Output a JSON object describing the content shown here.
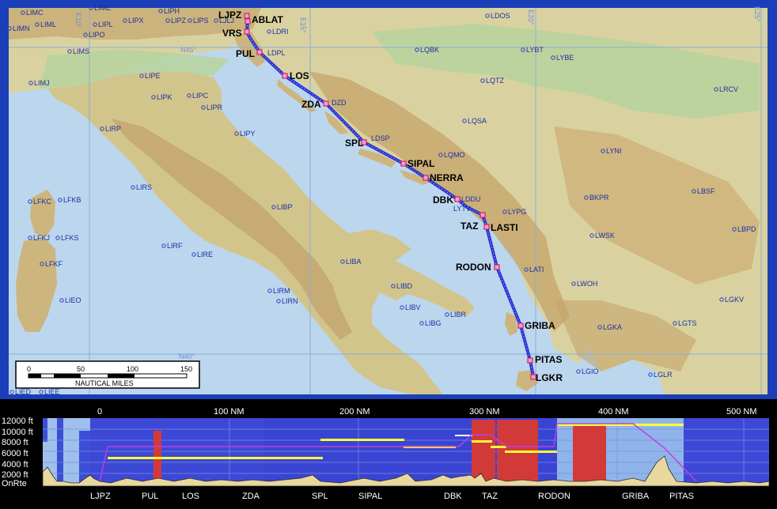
{
  "map": {
    "grid_labels": [
      "E10°",
      "E15°",
      "E20°",
      "E25°",
      "N45°",
      "N40°"
    ],
    "airports": [
      "LIMC",
      "LIME",
      "LIPH",
      "LIMN",
      "LIML",
      "LIPL",
      "LIPX",
      "LIPZ",
      "LIPS",
      "LJLJ",
      "LIPO",
      "LDRI",
      "LIMS",
      "LQBK",
      "LDOS",
      "LYBT",
      "LYBE",
      "LIPE",
      "LIMJ",
      "LIPK",
      "LIPC",
      "LIPR",
      "LQTZ",
      "LRCV",
      "LIRP",
      "LIPY",
      "LQSA",
      "LQMO",
      "LYNI",
      "LIRS",
      "LFKC",
      "LFKB",
      "LIBP",
      "LBSF",
      "LYPG",
      "BKPR",
      "LFKJ",
      "LFKS",
      "LIRF",
      "LIRE",
      "LIBA",
      "LWSK",
      "LBPD",
      "LFKF",
      "LATI",
      "LWOH",
      "LIRM",
      "LIRN",
      "LIBD",
      "LIEO",
      "LIBV",
      "LIBR",
      "LIBG",
      "LGKA",
      "LGTS",
      "LGKV",
      "LGIO",
      "LGLR",
      "LIED",
      "LIEE"
    ],
    "waypoints": [
      "LJPZ",
      "ABLAT",
      "VRS",
      "PUL",
      "LOS",
      "ZDA",
      "SPL",
      "SIPAL",
      "NERRA",
      "DBK",
      "TAZ",
      "LASTI",
      "RODON",
      "GRIBA",
      "PITAS",
      "LGKR"
    ],
    "route_tags": [
      "LDPL",
      "DZD",
      "LDSP",
      "LDDU",
      "LYTV"
    ],
    "scale": {
      "ticks": [
        "0",
        "50",
        "100",
        "150"
      ],
      "unit": "NAUTICAL MILES"
    }
  },
  "profile": {
    "distance_labels": [
      "0",
      "100 NM",
      "200 NM",
      "300 NM",
      "400 NM",
      "500 NM"
    ],
    "altitude_labels": [
      "12000 ft",
      "10000 ft",
      "8000 ft",
      "6000 ft",
      "4000 ft",
      "2000 ft",
      "OnRte"
    ],
    "waypoint_labels": [
      "LJPZ",
      "PUL",
      "LOS",
      "ZDA",
      "SPL",
      "SIPAL",
      "DBK",
      "TAZ",
      "RODON",
      "GRIBA",
      "PITAS"
    ]
  },
  "colors": {
    "route": "#2a2fd0",
    "waypoint": "#c8246e",
    "sea": "#bcd6ee",
    "frame": "#1a3fb8",
    "profile_bg": "#3a3fd8",
    "restricted": "#d23a3a",
    "airway": "#ffff33"
  }
}
